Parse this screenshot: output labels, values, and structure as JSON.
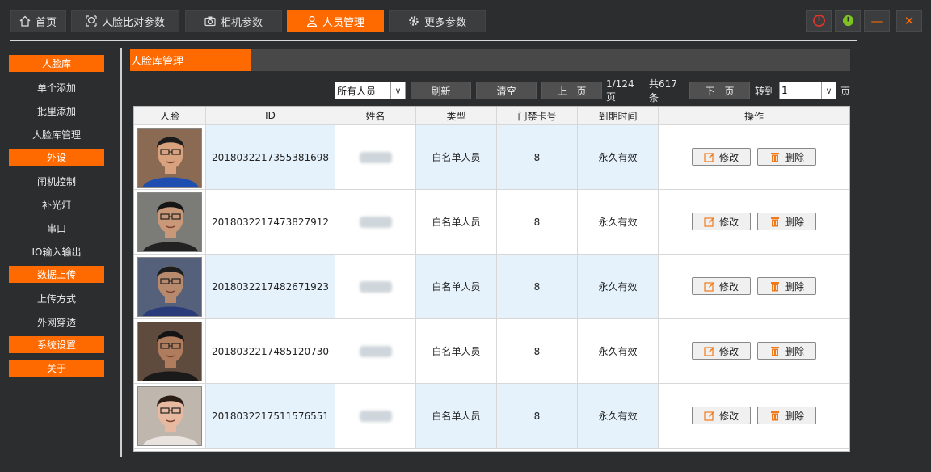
{
  "tabs": [
    {
      "label": "首页",
      "icon": "home-icon"
    },
    {
      "label": "人脸比对参数",
      "icon": "face-compare-icon"
    },
    {
      "label": "相机参数",
      "icon": "camera-icon"
    },
    {
      "label": "人员管理",
      "icon": "person-icon",
      "active": true
    },
    {
      "label": "更多参数",
      "icon": "gear-icon"
    }
  ],
  "window": {
    "power_icon": "power-icon",
    "status_icon": "status-icon",
    "minimize": "—",
    "close": "✕"
  },
  "sidebar": {
    "face_library": {
      "header": "人脸库",
      "items": [
        "单个添加",
        "批里添加",
        "人脸库管理"
      ]
    },
    "peripherals": {
      "header": "外设",
      "items": [
        "闸机控制",
        "补光灯",
        "串口",
        "IO输入输出"
      ]
    },
    "data_upload": {
      "header": "数据上传",
      "items": [
        "上传方式",
        "外网穿透"
      ]
    },
    "system_settings": {
      "header": "系统设置"
    },
    "about": {
      "header": "关于"
    }
  },
  "panel": {
    "title": "人脸库管理"
  },
  "toolbar": {
    "filter_value": "所有人员",
    "refresh_label": "刷新",
    "clear_label": "清空",
    "prev_label": "上一页",
    "page_info": "1/124 页",
    "total_info": "共617条",
    "next_label": "下一页",
    "goto_label": "转到",
    "goto_value": "1",
    "page_suffix": "页"
  },
  "table": {
    "headers": [
      "人脸",
      "ID",
      "姓名",
      "类型",
      "门禁卡号",
      "到期时间",
      "操作"
    ],
    "edit_label": "修改",
    "delete_label": "删除",
    "rows": [
      {
        "id": "2018032217355381698",
        "type": "白名单人员",
        "card": "8",
        "expire": "永久有效"
      },
      {
        "id": "2018032217473827912",
        "type": "白名单人员",
        "card": "8",
        "expire": "永久有效"
      },
      {
        "id": "2018032217482671923",
        "type": "白名单人员",
        "card": "8",
        "expire": "永久有效"
      },
      {
        "id": "2018032217485120730",
        "type": "白名单人员",
        "card": "8",
        "expire": "永久有效"
      },
      {
        "id": "2018032217511576551",
        "type": "白名单人员",
        "card": "8",
        "expire": "永久有效"
      }
    ]
  },
  "colors": {
    "accent": "#ff6a00",
    "background": "#2b2d2f",
    "row_highlight": "#e5f2fb"
  }
}
